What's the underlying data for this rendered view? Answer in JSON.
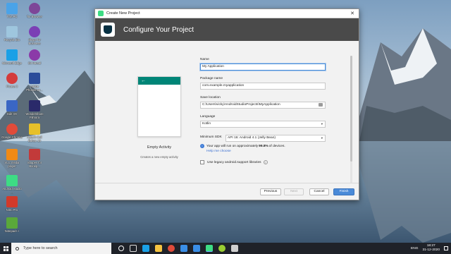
{
  "desktop": {
    "icons": [
      {
        "label": "This PC",
        "icon": "computer-icon",
        "color": "#4aa3e8"
      },
      {
        "label": "Tor Browser",
        "icon": "tor-browser-icon",
        "color": "#7d4698"
      },
      {
        "label": "Recycle Bin",
        "icon": "recycle-bin-icon",
        "color": "#9ec6de"
      },
      {
        "label": "Skype for Business",
        "icon": "skype-icon",
        "color": "#7b3fb5"
      },
      {
        "label": "Microsoft Edge",
        "icon": "edge-icon",
        "color": "#1aa0e6"
      },
      {
        "label": "Sit Harsal",
        "icon": "app-icon",
        "color": "#8b3aa8"
      },
      {
        "label": "Picasa 3",
        "icon": "picasa-icon",
        "color": "#d43b3b"
      },
      {
        "label": "Adobe Photoshop...",
        "icon": "photoshop-icon",
        "color": "#2b4c9a"
      },
      {
        "label": "Edit V8",
        "icon": "edit-icon",
        "color": "#3a66c4"
      },
      {
        "label": "Wondershare Filmora",
        "icon": "filmora-icon",
        "color": "#2a2a6a"
      },
      {
        "label": "Google Chrome",
        "icon": "chrome-icon",
        "color": "#e04b3a"
      },
      {
        "label": "Aptech Cell Bahan 10",
        "icon": "app-icon",
        "color": "#e6c02a"
      },
      {
        "label": "VLC media player",
        "icon": "vlc-icon",
        "color": "#f08a16"
      },
      {
        "label": "Shapes for Bookp...",
        "icon": "app-icon",
        "color": "#c23a3a"
      },
      {
        "label": "Android Studio ...",
        "icon": "android-studio-icon",
        "color": "#3ddc84"
      },
      {
        "label": "Nitro Pro",
        "icon": "app-icon",
        "color": "#d23a2a"
      },
      {
        "label": "Gyakusoft Control...",
        "icon": "app-icon",
        "color": "#2a4a8a"
      },
      {
        "label": "Notepad++",
        "icon": "notepad-icon",
        "color": "#5aa83a"
      }
    ]
  },
  "dialog": {
    "window_title": "Create New Project",
    "header_title": "Configure Your Project",
    "template": {
      "name": "Empty Activity",
      "description": "Creates a new empty activity",
      "back_arrow": "←"
    },
    "fields": {
      "name": {
        "label": "Name",
        "value": "My Application"
      },
      "package": {
        "label": "Package name",
        "value": "com.example.myapplication"
      },
      "save_location": {
        "label": "Save location",
        "value": "C:\\Users\\vicky\\AndroidStudioProjects\\MyApplication"
      },
      "language": {
        "label": "Language",
        "value": "Kotlin"
      },
      "min_sdk": {
        "label": "Minimum SDK",
        "value": "API 16: Android 4.1 (Jelly Bean)"
      }
    },
    "info": {
      "prefix": "Your app will run on approximately ",
      "percent": "99.8%",
      "suffix": " of devices.",
      "help_link": "Help me choose"
    },
    "legacy_label": "Use legacy android.support libraries",
    "buttons": {
      "previous": "Previous",
      "next": "Next",
      "cancel": "Cancel",
      "finish": "Finish"
    },
    "accent_color": "#008577"
  },
  "taskbar": {
    "search_placeholder": "Type here to search",
    "language": "ENG",
    "time": "18:27",
    "date": "31-12-2020",
    "pinned": [
      {
        "icon": "task-view-icon",
        "color": "#ffffff"
      },
      {
        "icon": "edge-icon",
        "color": "#1aa0e6"
      },
      {
        "icon": "file-explorer-icon",
        "color": "#f5c341"
      },
      {
        "icon": "chrome-icon",
        "color": "#e04b3a"
      },
      {
        "icon": "store-icon",
        "color": "#3a8ee6"
      },
      {
        "icon": "mail-icon",
        "color": "#3a8ee6"
      },
      {
        "icon": "android-studio-icon",
        "color": "#3ddc84"
      },
      {
        "icon": "app-icon",
        "color": "#9acd32"
      },
      {
        "icon": "app-icon",
        "color": "#cfcfcf"
      }
    ]
  }
}
